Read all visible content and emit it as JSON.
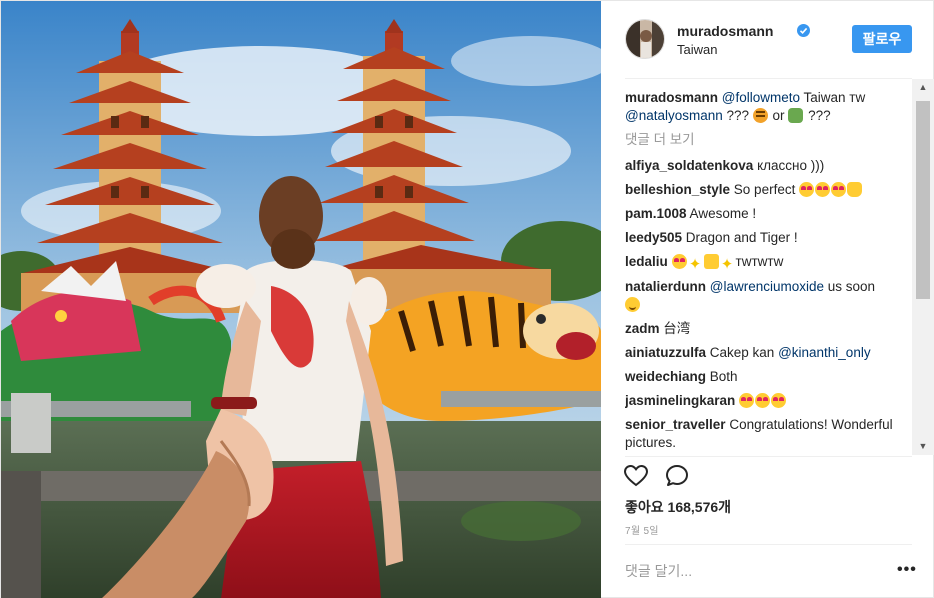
{
  "post": {
    "username": "muradosmann",
    "location": "Taiwan",
    "follow_label": "팔로우",
    "caption": {
      "user": "muradosmann",
      "mention1": "@followmeto",
      "text1": " Taiwan тw ",
      "mention2": "@natalyosmann",
      "text2": " ??? ",
      "text3": " or ",
      "text4": " ???"
    },
    "load_more": "댓글 더 보기",
    "comments": [
      {
        "user": "alfiya_soldatenkova",
        "text": " классно )))"
      },
      {
        "user": "belleshion_style",
        "text": " So perfect "
      },
      {
        "user": "pam.1008",
        "text": " Awesome !"
      },
      {
        "user": "leedy505",
        "text": " Dragon and Tiger !"
      },
      {
        "user": "ledaliu",
        "text": "тwтwтw"
      },
      {
        "user": "natalierdunn",
        "mention": " @lawrenciumoxide",
        "text": " us soon"
      },
      {
        "user": "zadm",
        "text": " 台湾"
      },
      {
        "user": "ainiatuzzulfa",
        "text": " Cakep kan ",
        "mention": "@kinanthi_only"
      },
      {
        "user": "weidechiang",
        "text": " Both"
      },
      {
        "user": "jasminelingkaran",
        "text": " "
      },
      {
        "user": "senior_traveller",
        "text": " Congratulations! Wonderful pictures."
      }
    ],
    "likes": "좋아요 168,576개",
    "date": "7월 5일",
    "add_comment_placeholder": "댓글 달기...",
    "more_options": "•••",
    "icons": {
      "like": "heart-icon",
      "comment": "comment-bubble-icon",
      "verified": "verified-badge-icon"
    },
    "colors": {
      "accent": "#3897f0",
      "mention": "#003569",
      "muted": "#999999"
    }
  }
}
